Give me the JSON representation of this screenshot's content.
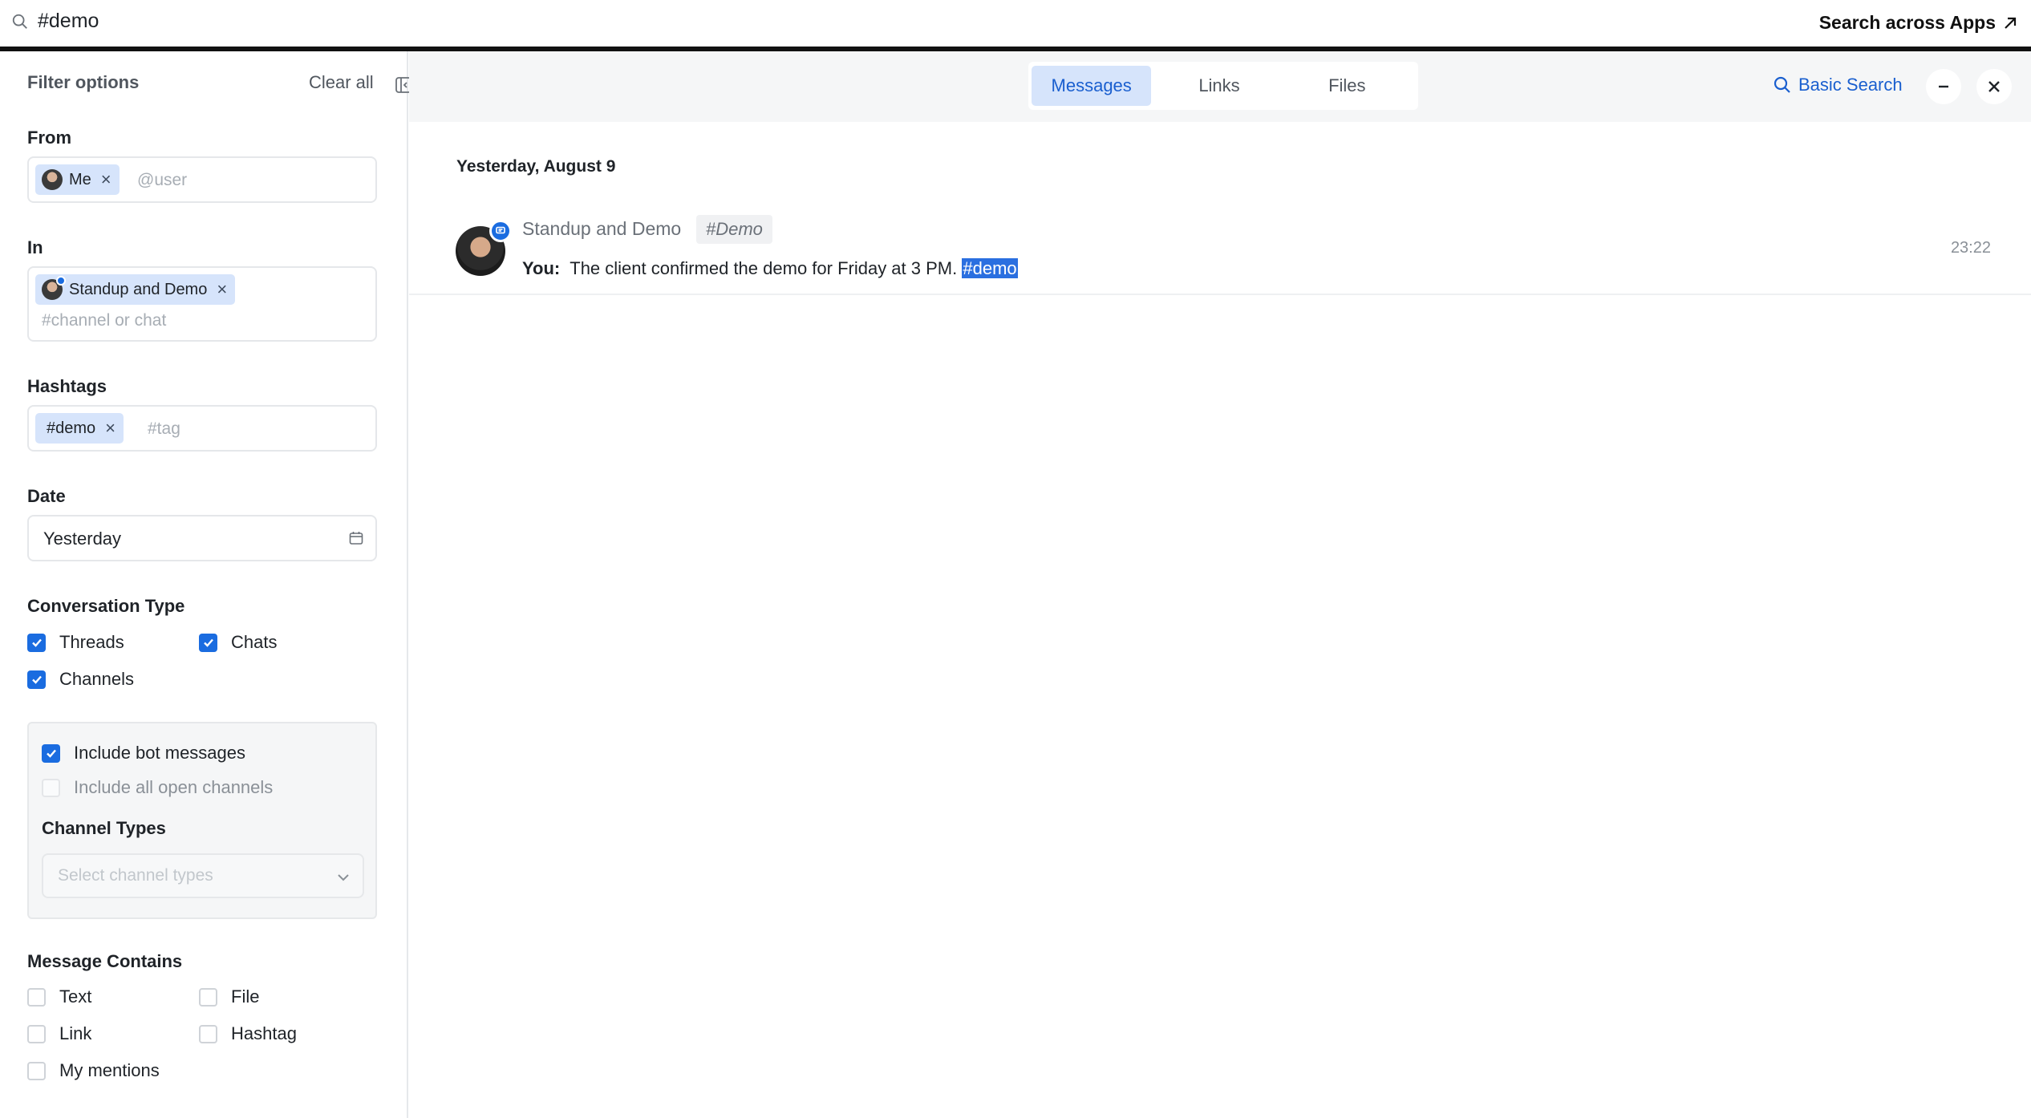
{
  "topbar": {
    "query": "#demo",
    "search_across_label": "Search across Apps"
  },
  "sidebar": {
    "title": "Filter options",
    "clear_all": "Clear all",
    "from": {
      "label": "From",
      "chip": "Me",
      "placeholder": "@user"
    },
    "in": {
      "label": "In",
      "chip": "Standup and Demo",
      "placeholder": "#channel or chat"
    },
    "hashtags": {
      "label": "Hashtags",
      "chip": "#demo",
      "placeholder": "#tag"
    },
    "date": {
      "label": "Date",
      "value": "Yesterday"
    },
    "conversation_type": {
      "label": "Conversation Type",
      "options": [
        {
          "label": "Threads",
          "checked": true
        },
        {
          "label": "Chats",
          "checked": true
        },
        {
          "label": "Channels",
          "checked": true
        }
      ]
    },
    "channel_panel": {
      "include_bot": {
        "label": "Include bot messages",
        "checked": true
      },
      "include_open": {
        "label": "Include all open channels",
        "checked": false
      },
      "channel_types_label": "Channel Types",
      "channel_types_placeholder": "Select channel types"
    },
    "message_contains": {
      "label": "Message Contains",
      "options": [
        {
          "label": "Text",
          "checked": false
        },
        {
          "label": "File",
          "checked": false
        },
        {
          "label": "Link",
          "checked": false
        },
        {
          "label": "Hashtag",
          "checked": false
        },
        {
          "label": "My mentions",
          "checked": false
        }
      ]
    }
  },
  "main": {
    "tabs": [
      {
        "label": "Messages",
        "active": true
      },
      {
        "label": "Links",
        "active": false
      },
      {
        "label": "Files",
        "active": false
      }
    ],
    "basic_search": "Basic Search",
    "date_heading": "Yesterday, August 9",
    "results": [
      {
        "title": "Standup and Demo",
        "channel": "#Demo",
        "sender": "You:",
        "text": "The client confirmed the demo for Friday at 3 PM.",
        "hashtag": "#demo",
        "time": "23:22"
      }
    ]
  },
  "colors": {
    "accent": "#1a6ce0",
    "chip_bg": "#d6e4fb",
    "highlight": "#2a6fe0"
  }
}
